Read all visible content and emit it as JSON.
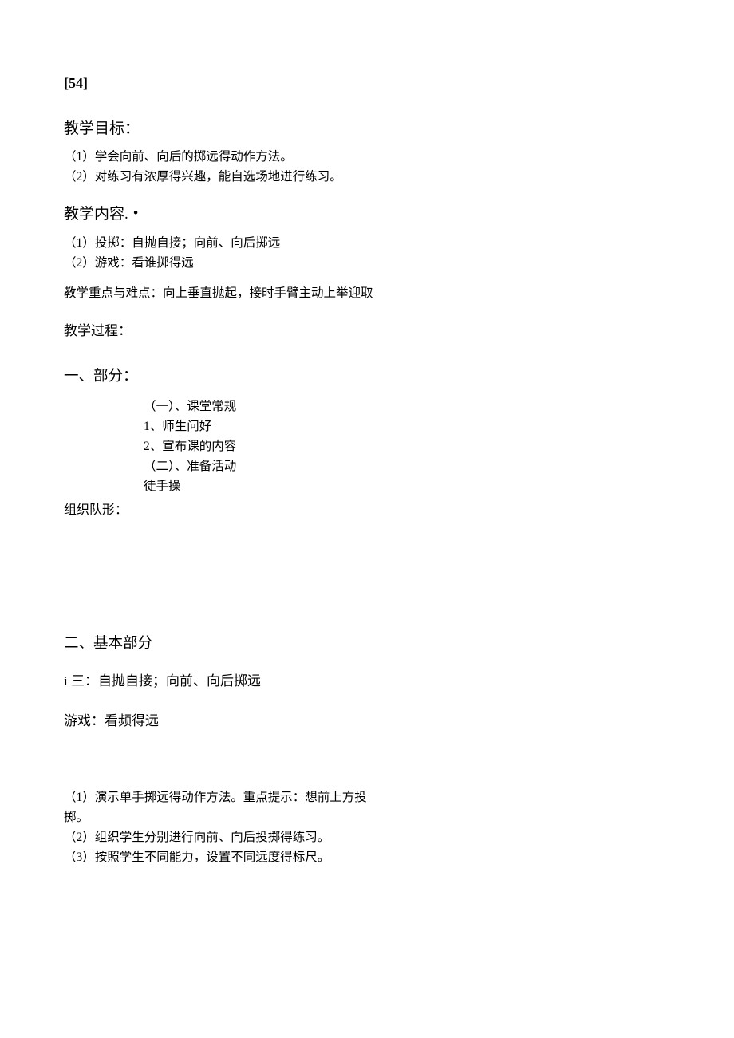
{
  "header": {
    "number": "[54]"
  },
  "sections": {
    "objectives": {
      "title": "教学目标：",
      "items": [
        "（1）学会向前、向后的掷远得动作方法。",
        "（2）对练习有浓厚得兴趣，能自选场地进行练习。"
      ]
    },
    "content": {
      "title": "教学内容.",
      "items": [
        "（1）投掷：自抛自接；向前、向后掷远",
        "（2）游戏：看谁掷得远"
      ]
    },
    "keypoints": {
      "text": "教学重点与难点：向上垂直抛起，接时手臂主动上举迎取"
    },
    "process": {
      "title": "教学过程："
    },
    "part1": {
      "title": "一、部分：",
      "sub": [
        "（一）、课堂常规",
        " 1、师生问好",
        " 2、宣布课的内容",
        "（二）、准备活动",
        "  徒手操"
      ],
      "formation": "组织队形："
    },
    "part2": {
      "title": "二、基本部分",
      "line1": "i 三：自抛自接；向前、向后掷远",
      "line2": "游戏：看频得远",
      "items": [
        "（1）演示单手掷远得动作方法。重点提示：想前上方投",
        "掷。",
        "（2）组织学生分别进行向前、向后投掷得练习。",
        "（3）按照学生不同能力，设置不同远度得标尺。"
      ]
    }
  }
}
